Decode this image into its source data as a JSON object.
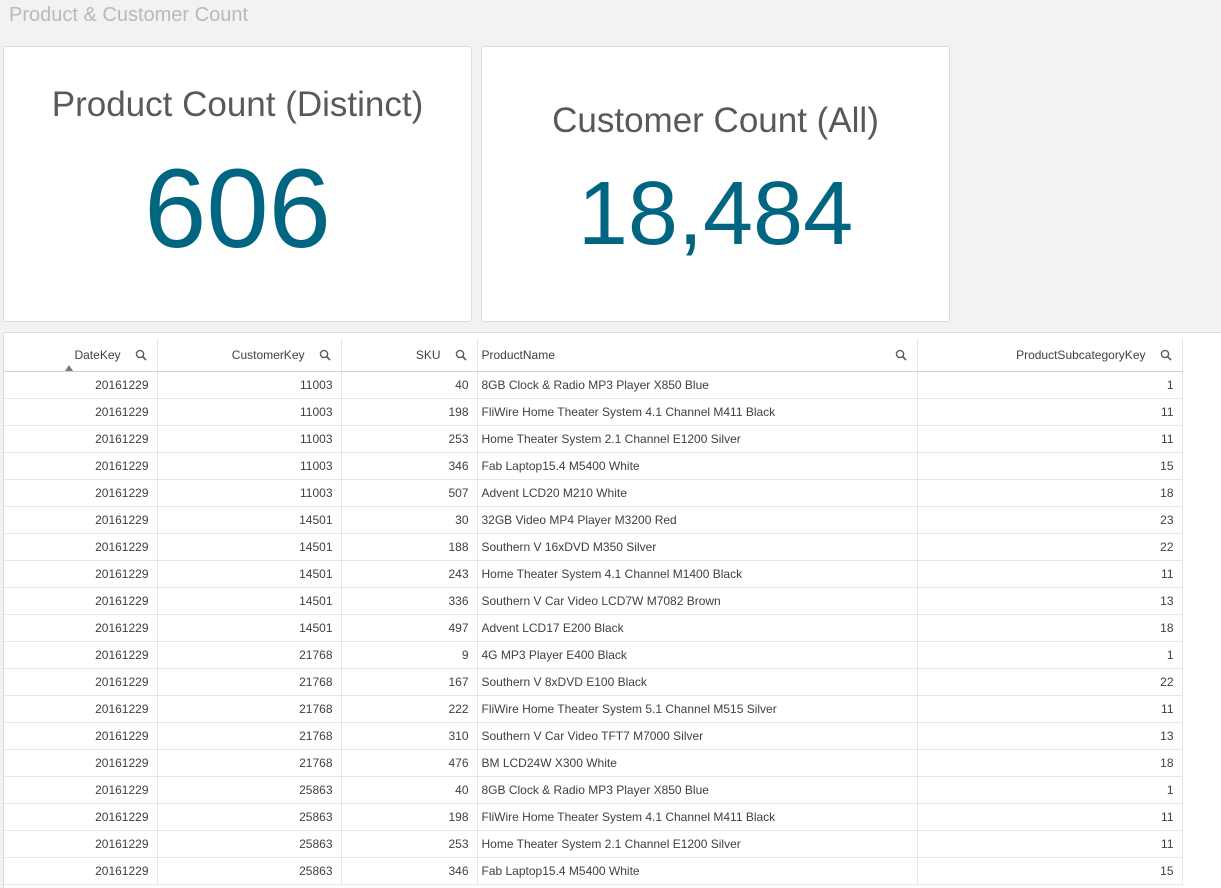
{
  "page": {
    "title": "Product & Customer Count"
  },
  "kpis": [
    {
      "title": "Product Count (Distinct)",
      "value": "606"
    },
    {
      "title": "Customer Count (All)",
      "value": "18,484"
    }
  ],
  "colors": {
    "kpi_value": "#006580",
    "background": "#f2f2f2"
  },
  "table": {
    "sorted_column": "DateKey",
    "sort_direction": "ascending",
    "columns": [
      {
        "label": "DateKey",
        "search_icon": "search-icon"
      },
      {
        "label": "CustomerKey",
        "search_icon": "search-icon"
      },
      {
        "label": "SKU",
        "search_icon": "search-icon"
      },
      {
        "label": "ProductName",
        "search_icon": "search-icon"
      },
      {
        "label": "ProductSubcategoryKey",
        "search_icon": "search-icon"
      }
    ],
    "rows": [
      [
        "20161229",
        "11003",
        "40",
        "8GB Clock & Radio MP3 Player X850 Blue",
        "1"
      ],
      [
        "20161229",
        "11003",
        "198",
        "FliWire Home Theater System 4.1 Channel M411 Black",
        "11"
      ],
      [
        "20161229",
        "11003",
        "253",
        "Home Theater System 2.1 Channel E1200 Silver",
        "11"
      ],
      [
        "20161229",
        "11003",
        "346",
        "Fab Laptop15.4 M5400 White",
        "15"
      ],
      [
        "20161229",
        "11003",
        "507",
        "Advent LCD20 M210 White",
        "18"
      ],
      [
        "20161229",
        "14501",
        "30",
        "32GB Video MP4 Player M3200 Red",
        "23"
      ],
      [
        "20161229",
        "14501",
        "188",
        "Southern V 16xDVD M350 Silver",
        "22"
      ],
      [
        "20161229",
        "14501",
        "243",
        "Home Theater System 4.1 Channel M1400 Black",
        "11"
      ],
      [
        "20161229",
        "14501",
        "336",
        "Southern V Car Video LCD7W M7082 Brown",
        "13"
      ],
      [
        "20161229",
        "14501",
        "497",
        "Advent LCD17 E200 Black",
        "18"
      ],
      [
        "20161229",
        "21768",
        "9",
        "4G MP3 Player E400 Black",
        "1"
      ],
      [
        "20161229",
        "21768",
        "167",
        "Southern V 8xDVD E100 Black",
        "22"
      ],
      [
        "20161229",
        "21768",
        "222",
        "FliWire Home Theater System 5.1 Channel M515 Silver",
        "11"
      ],
      [
        "20161229",
        "21768",
        "310",
        "Southern V Car Video TFT7 M7000 Silver",
        "13"
      ],
      [
        "20161229",
        "21768",
        "476",
        "BM LCD24W X300 White",
        "18"
      ],
      [
        "20161229",
        "25863",
        "40",
        "8GB Clock & Radio MP3 Player X850 Blue",
        "1"
      ],
      [
        "20161229",
        "25863",
        "198",
        "FliWire Home Theater System 4.1 Channel M411 Black",
        "11"
      ],
      [
        "20161229",
        "25863",
        "253",
        "Home Theater System 2.1 Channel E1200 Silver",
        "11"
      ],
      [
        "20161229",
        "25863",
        "346",
        "Fab Laptop15.4 M5400 White",
        "15"
      ]
    ]
  }
}
